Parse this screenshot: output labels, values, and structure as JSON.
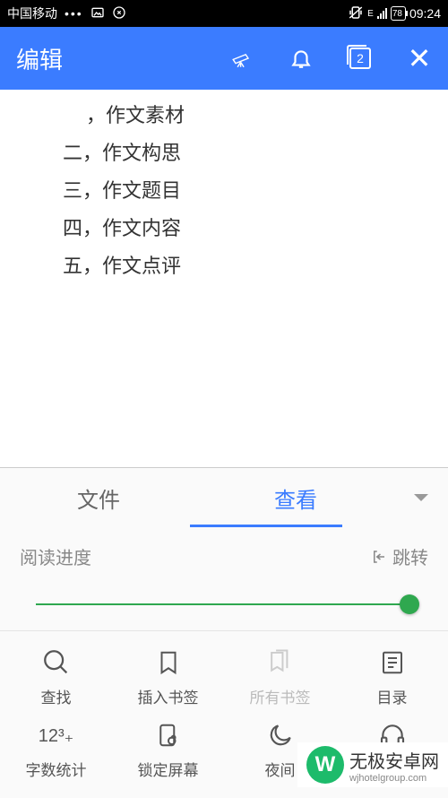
{
  "status": {
    "carrier": "中国移动",
    "network": "E",
    "battery": "78",
    "time": "09:24"
  },
  "header": {
    "title": "编辑",
    "tab_count": "2"
  },
  "document": {
    "lines": [
      "，作文素材",
      "二，作文构思",
      "三，作文题目",
      "四，作文内容",
      "五，作文点评"
    ]
  },
  "panel": {
    "tabs": {
      "file": "文件",
      "view": "查看"
    },
    "progress_label": "阅读进度",
    "jump_label": "跳转",
    "tools": {
      "find": "查找",
      "insert_bookmark": "插入书签",
      "all_bookmarks": "所有书签",
      "toc": "目录",
      "word_count": "字数统计",
      "lock_screen": "锁定屏幕",
      "night_mode": "夜间"
    }
  },
  "watermark": {
    "logo": "W",
    "text": "无极安卓网",
    "url": "wjhotelgroup.com"
  }
}
